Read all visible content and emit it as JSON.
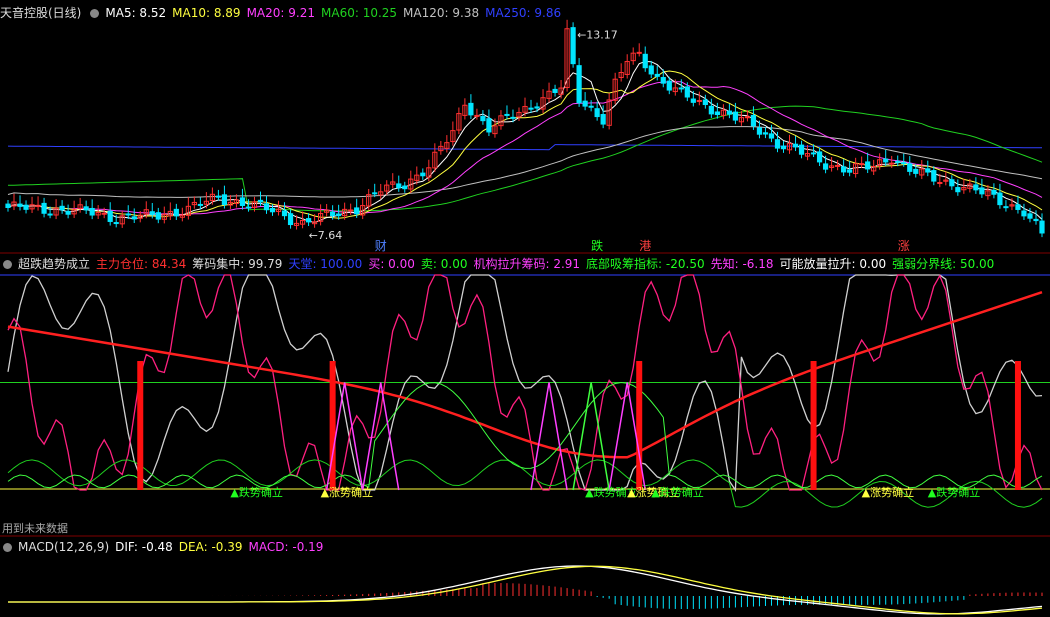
{
  "colors": {
    "bg": "#000000",
    "up": "#ff3030",
    "down": "#00e5ff",
    "ma5": "#ffffff",
    "ma10": "#ffff40",
    "ma20": "#ff40ff",
    "ma60": "#20d020",
    "ma120": "#c0c0c0",
    "ma250": "#3040ff",
    "grid": "#800000"
  },
  "panel1": {
    "title": "天音控股(日线)",
    "indicators": [
      {
        "label": "MA5: 8.52",
        "color": "#ffffff"
      },
      {
        "label": "MA10: 8.89",
        "color": "#ffff40"
      },
      {
        "label": "MA20: 9.21",
        "color": "#ff40ff"
      },
      {
        "label": "MA60: 10.25",
        "color": "#20d020"
      },
      {
        "label": "MA120: 9.38",
        "color": "#c0c0c0"
      },
      {
        "label": "MA250: 9.86",
        "color": "#3040ff"
      }
    ],
    "high_label": "13.17",
    "low_label": "7.64",
    "markers": [
      {
        "text": "财",
        "x_index": 61,
        "color": "#5080ff"
      },
      {
        "text": "跌",
        "x_index": 97,
        "color": "#20ff20"
      },
      {
        "text": "港",
        "x_index": 105,
        "color": "#ff4040"
      },
      {
        "text": "涨",
        "x_index": 148,
        "color": "#ff4040"
      }
    ]
  },
  "panel2": {
    "indicators": [
      {
        "label": "超跌趋势成立",
        "color": "#dddddd"
      },
      {
        "label": "主力仓位: 84.34",
        "color": "#ff3030"
      },
      {
        "label": "筹码集中: 99.79",
        "color": "#dddddd"
      },
      {
        "label": "天堂: 100.00",
        "color": "#3040ff"
      },
      {
        "label": "买: 0.00",
        "color": "#ff40ff"
      },
      {
        "label": "卖: 0.00",
        "color": "#20ff20"
      },
      {
        "label": "机构拉升筹码: 2.91",
        "color": "#ff40ff"
      },
      {
        "label": "底部吸筹指标: -20.50",
        "color": "#20ff20"
      },
      {
        "label": "先知: -6.18",
        "color": "#ff40ff"
      },
      {
        "label": "可能放量拉升: 0.00",
        "color": "#ffffff"
      },
      {
        "label": "强弱分界线: 50.00",
        "color": "#20ff20"
      }
    ],
    "signals": [
      {
        "text": "跌势确立",
        "x_index": 37,
        "color": "#20ff20"
      },
      {
        "text": "涨势确立",
        "x_index": 52,
        "color": "#ffff40"
      },
      {
        "text": "跌势确立",
        "x_index": 96,
        "color": "#20ff20"
      },
      {
        "text": "涨势确立",
        "x_index": 103,
        "color": "#ffff40"
      },
      {
        "text": "跌势确立",
        "x_index": 107,
        "color": "#20ff20"
      },
      {
        "text": "涨势确立",
        "x_index": 142,
        "color": "#ffff40"
      },
      {
        "text": "跌势确立",
        "x_index": 153,
        "color": "#20ff20"
      }
    ],
    "footnote": "用到未来数据"
  },
  "panel3": {
    "indicators": [
      {
        "label": "MACD(12,26,9)",
        "color": "#dddddd"
      },
      {
        "label": "DIF: -0.48",
        "color": "#ffffff"
      },
      {
        "label": "DEA: -0.39",
        "color": "#ffff40"
      },
      {
        "label": "MACD: -0.19",
        "color": "#ff40ff"
      }
    ]
  },
  "chart_data": {
    "type": "candlestick",
    "bar_count": 173,
    "price_ylim": [
      7.0,
      13.6
    ],
    "key_close": [
      [
        0,
        8.1
      ],
      [
        8,
        8.05
      ],
      [
        14,
        7.95
      ],
      [
        18,
        7.8
      ],
      [
        24,
        7.85
      ],
      [
        30,
        8.05
      ],
      [
        35,
        8.4
      ],
      [
        40,
        8.2
      ],
      [
        45,
        7.95
      ],
      [
        49,
        7.64
      ],
      [
        54,
        7.9
      ],
      [
        58,
        8.1
      ],
      [
        62,
        8.6
      ],
      [
        66,
        8.8
      ],
      [
        70,
        9.3
      ],
      [
        74,
        10.3
      ],
      [
        76,
        11.2
      ],
      [
        80,
        10.4
      ],
      [
        84,
        10.8
      ],
      [
        88,
        11.2
      ],
      [
        92,
        11.6
      ],
      [
        93,
        13.17
      ],
      [
        95,
        11.3
      ],
      [
        99,
        10.7
      ],
      [
        101,
        11.7
      ],
      [
        103,
        12.4
      ],
      [
        105,
        12.6
      ],
      [
        108,
        11.9
      ],
      [
        112,
        11.4
      ],
      [
        116,
        11.1
      ],
      [
        120,
        10.8
      ],
      [
        124,
        10.5
      ],
      [
        128,
        10.0
      ],
      [
        132,
        9.7
      ],
      [
        136,
        9.4
      ],
      [
        140,
        9.2
      ],
      [
        144,
        9.3
      ],
      [
        147,
        9.6
      ],
      [
        150,
        9.2
      ],
      [
        153,
        9.0
      ],
      [
        157,
        8.8
      ],
      [
        161,
        8.6
      ],
      [
        165,
        8.3
      ],
      [
        169,
        8.0
      ],
      [
        172,
        7.3
      ]
    ],
    "ma_levels": {
      "ma120_start": 9.05,
      "ma250_start": 9.9,
      "ma250_end": 9.7
    }
  }
}
